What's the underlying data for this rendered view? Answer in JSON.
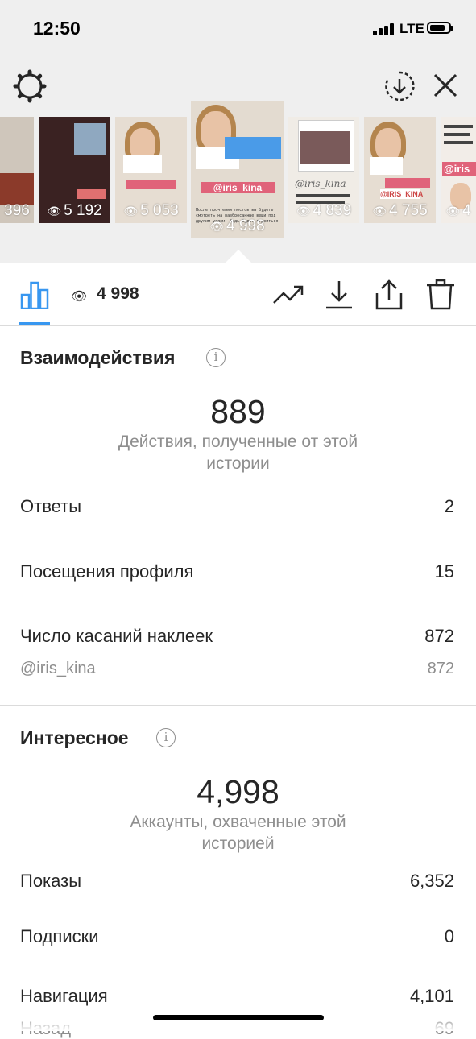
{
  "status_bar": {
    "time": "12:50",
    "network": "LTE"
  },
  "story_tray": {
    "thumbnails": [
      {
        "views": "396"
      },
      {
        "views": "5 192"
      },
      {
        "views": "5 053"
      },
      {
        "views": "4 998",
        "selected": true,
        "caption_tag": "@iris_kina",
        "caption_text": "После прочтения постов вы будете смотреть на разбросанные вещи под другим углом. Ведь будет строиться"
      },
      {
        "views": "4 839",
        "caption_tag": "@iris_kina"
      },
      {
        "views": "4 755",
        "caption_tag": "@IRIS_KINA"
      },
      {
        "views": "4",
        "caption_tag": "@iris"
      }
    ]
  },
  "toolbar": {
    "views": "4 998",
    "icons": [
      "chart-icon",
      "eye-icon",
      "trending-icon",
      "download-icon",
      "share-icon",
      "trash-icon"
    ],
    "accent_color": "#3897f0"
  },
  "interactions": {
    "title": "Взаимодействия",
    "total": "889",
    "total_caption": "Действия, полученные от этой истории",
    "rows": [
      {
        "label": "Ответы",
        "value": "2"
      },
      {
        "label": "Посещения профиля",
        "value": "15"
      },
      {
        "label": "Число касаний наклеек",
        "value": "872"
      }
    ],
    "sticker_rows": [
      {
        "label": "@iris_kina",
        "value": "872"
      }
    ]
  },
  "discovery": {
    "title": "Интересное",
    "total": "4,998",
    "total_caption": "Аккаунты, охваченные этой историей",
    "rows": [
      {
        "label": "Показы",
        "value": "6,352"
      },
      {
        "label": "Подписки",
        "value": "0"
      },
      {
        "label": "Навигация",
        "value": "4,101"
      },
      {
        "label": "Назад",
        "value": "69"
      }
    ]
  }
}
